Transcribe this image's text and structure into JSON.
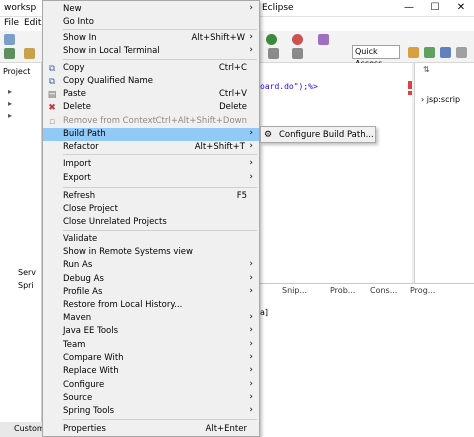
{
  "window": {
    "title_left": "worksp",
    "title_right": "Eclipse",
    "controls": [
      "—",
      "☐",
      "✕"
    ]
  },
  "menubar": {
    "file": "File",
    "edit": "Edit"
  },
  "toolbar": {
    "quick_access": "Quick Access"
  },
  "left_panel": {
    "tab": "Project",
    "items": [
      "Serv",
      "Spri"
    ],
    "status": "Custome"
  },
  "editor": {
    "code": "oard.do\");%>"
  },
  "right_panel": {
    "item": "jsp:scrip"
  },
  "bottom_panel": {
    "tabs": [
      "Snip...",
      "Prob...",
      "Cons...",
      "Prog..."
    ],
    "glyph": "a]"
  },
  "context_menu": {
    "items": [
      {
        "label": "New",
        "shortcut": "",
        "arrow": true
      },
      {
        "label": "Go Into",
        "shortcut": "",
        "arrow": false
      },
      {
        "label": "Show In",
        "shortcut": "Alt+Shift+W",
        "arrow": true
      },
      {
        "label": "Show in Local Terminal",
        "shortcut": "",
        "arrow": true
      },
      {
        "label": "Copy",
        "shortcut": "Ctrl+C",
        "arrow": false
      },
      {
        "label": "Copy Qualified Name",
        "shortcut": "",
        "arrow": false
      },
      {
        "label": "Paste",
        "shortcut": "Ctrl+V",
        "arrow": false
      },
      {
        "label": "Delete",
        "shortcut": "Delete",
        "arrow": false
      },
      {
        "label": "Remove from Context",
        "shortcut": "Ctrl+Alt+Shift+Down",
        "arrow": false
      },
      {
        "label": "Build Path",
        "shortcut": "",
        "arrow": true
      },
      {
        "label": "Refactor",
        "shortcut": "Alt+Shift+T",
        "arrow": true
      },
      {
        "label": "Import",
        "shortcut": "",
        "arrow": true
      },
      {
        "label": "Export",
        "shortcut": "",
        "arrow": true
      },
      {
        "label": "Refresh",
        "shortcut": "F5",
        "arrow": false
      },
      {
        "label": "Close Project",
        "shortcut": "",
        "arrow": false
      },
      {
        "label": "Close Unrelated Projects",
        "shortcut": "",
        "arrow": false
      },
      {
        "label": "Validate",
        "shortcut": "",
        "arrow": false
      },
      {
        "label": "Show in Remote Systems view",
        "shortcut": "",
        "arrow": false
      },
      {
        "label": "Run As",
        "shortcut": "",
        "arrow": true
      },
      {
        "label": "Debug As",
        "shortcut": "",
        "arrow": true
      },
      {
        "label": "Profile As",
        "shortcut": "",
        "arrow": true
      },
      {
        "label": "Restore from Local History...",
        "shortcut": "",
        "arrow": false
      },
      {
        "label": "Maven",
        "shortcut": "",
        "arrow": true
      },
      {
        "label": "Java EE Tools",
        "shortcut": "",
        "arrow": true
      },
      {
        "label": "Team",
        "shortcut": "",
        "arrow": true
      },
      {
        "label": "Compare With",
        "shortcut": "",
        "arrow": true
      },
      {
        "label": "Replace With",
        "shortcut": "",
        "arrow": true
      },
      {
        "label": "Configure",
        "shortcut": "",
        "arrow": true
      },
      {
        "label": "Source",
        "shortcut": "",
        "arrow": true
      },
      {
        "label": "Spring Tools",
        "shortcut": "",
        "arrow": true
      },
      {
        "label": "Properties",
        "shortcut": "Alt+Enter",
        "arrow": false
      }
    ],
    "arrow_glyph": "›"
  },
  "submenu": {
    "configure_build_path": "Configure Build Path..."
  }
}
